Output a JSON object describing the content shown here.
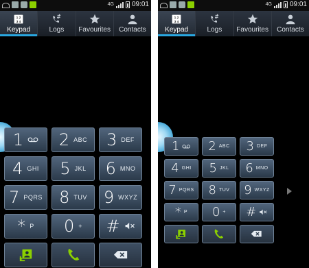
{
  "status_bar": {
    "time": "09:01",
    "network": "4G"
  },
  "tabs": [
    {
      "label": "Keypad",
      "icon": "keypad-icon",
      "active": true
    },
    {
      "label": "Logs",
      "icon": "logs-icon",
      "active": false
    },
    {
      "label": "Favourites",
      "icon": "star-icon",
      "active": false
    },
    {
      "label": "Contacts",
      "icon": "contact-icon",
      "active": false
    }
  ],
  "keys": [
    {
      "num": "1",
      "letters": "",
      "extra_icon": "voicemail-icon"
    },
    {
      "num": "2",
      "letters": "ABC"
    },
    {
      "num": "3",
      "letters": "DEF"
    },
    {
      "num": "4",
      "letters": "GHI"
    },
    {
      "num": "5",
      "letters": "JKL"
    },
    {
      "num": "6",
      "letters": "MNO"
    },
    {
      "num": "7",
      "letters": "PQRS"
    },
    {
      "num": "8",
      "letters": "TUV"
    },
    {
      "num": "9",
      "letters": "WXYZ"
    },
    {
      "num": "*",
      "letters": "P"
    },
    {
      "num": "0",
      "letters": "+"
    },
    {
      "num": "#",
      "letters": "",
      "extra_icon": "mute-icon"
    }
  ],
  "actions": [
    {
      "name": "add-contact-button",
      "icon": "add-contact-icon"
    },
    {
      "name": "call-button",
      "icon": "phone-icon"
    },
    {
      "name": "backspace-button",
      "icon": "backspace-icon"
    }
  ],
  "colors": {
    "accent": "#2aa7e0",
    "call_green": "#8bd000",
    "key_top": "#51657c",
    "key_bottom": "#2b3a4a",
    "background": "#000000"
  }
}
